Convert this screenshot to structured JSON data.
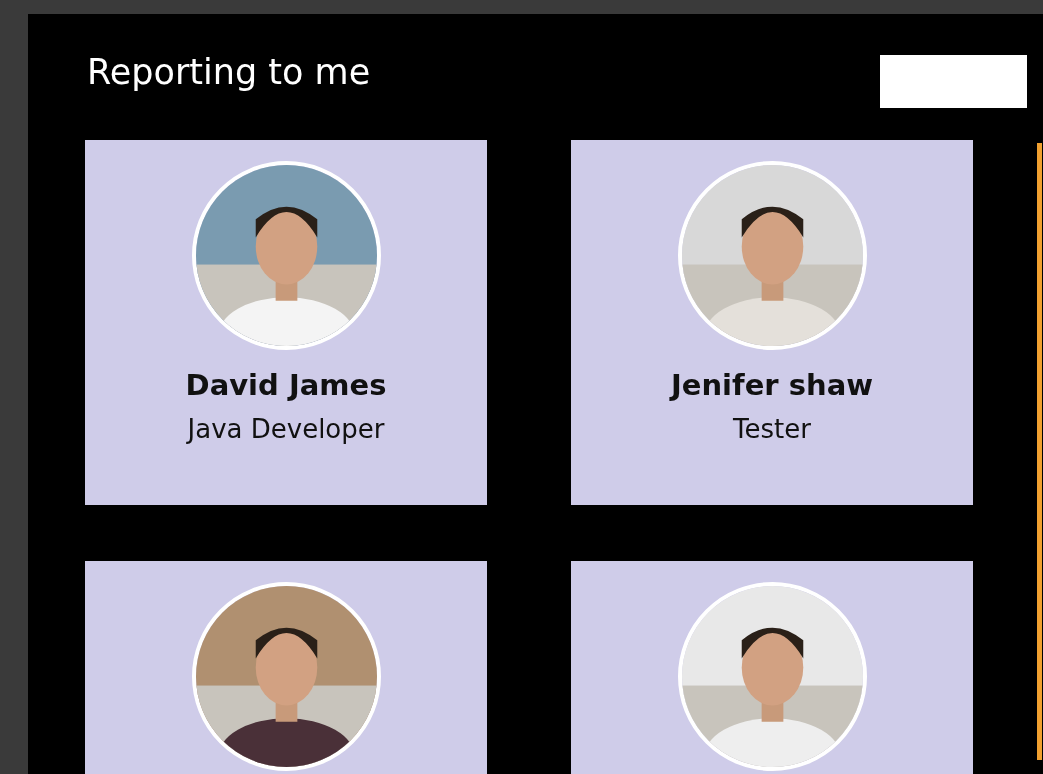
{
  "title": "Reporting to me",
  "people": [
    {
      "kind": "person",
      "name": "David James",
      "role": "Java Developer"
    },
    {
      "kind": "person",
      "name": "Jenifer shaw",
      "role": "Tester"
    },
    {
      "kind": "picture"
    },
    {
      "kind": "picture"
    }
  ]
}
